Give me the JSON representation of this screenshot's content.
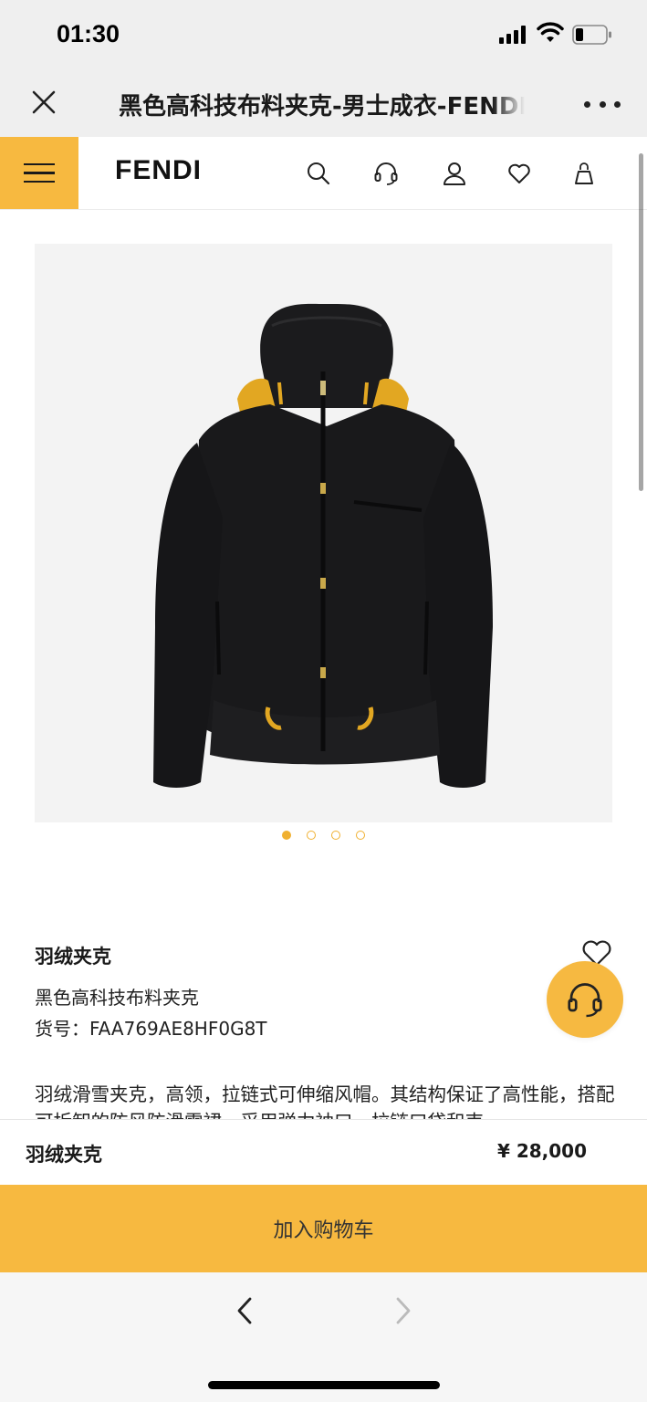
{
  "status_bar": {
    "time": "01:30"
  },
  "browser": {
    "page_title": "黑色高科技布料夹克-男士成衣-FENDI"
  },
  "site": {
    "brand": "FENDI",
    "accent_color": "#f7b940",
    "header_icons": [
      "search-icon",
      "headset-icon",
      "user-icon",
      "heart-icon",
      "bag-icon"
    ]
  },
  "gallery": {
    "total_images": 4,
    "active_index": 0
  },
  "product": {
    "category": "羽绒夹克",
    "name": "黑色高科技布料夹克",
    "sku_label": "货号：",
    "sku": "FAA769AE8HF0G8T",
    "description": "羽绒滑雪夹克，高领，拉链式可伸缩风帽。其结构保证了高性能，搭配可拆卸的防风防滑雪裙，采用弹力袖口，拉链口袋和束"
  },
  "purchase": {
    "product_name": "羽绒夹克",
    "price": "¥ 28,000",
    "add_to_cart_label": "加入购物车"
  }
}
